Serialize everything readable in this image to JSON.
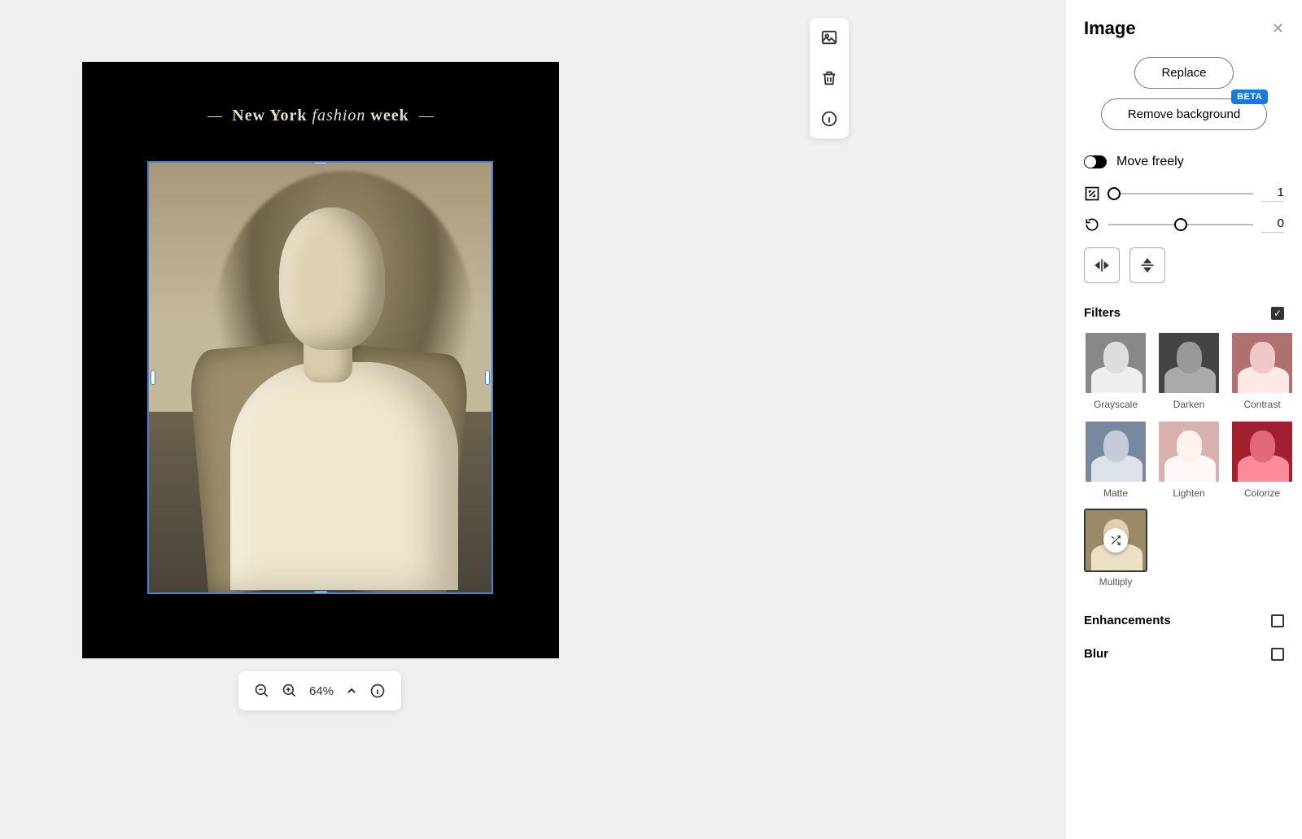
{
  "canvas": {
    "poster_title_prefix": "New York",
    "poster_title_italic": "fashion",
    "poster_title_suffix": "week"
  },
  "actions": {
    "image": "image-icon",
    "trash": "trash-icon",
    "info": "info-icon"
  },
  "zoom": {
    "percent": "64%"
  },
  "panel": {
    "title": "Image",
    "replace_label": "Replace",
    "remove_bg_label": "Remove background",
    "beta_label": "BETA",
    "move_freely_label": "Move freely",
    "move_freely_on": false,
    "scale_value": "1",
    "rotate_value": "0",
    "filters_title": "Filters",
    "filters_enabled": true,
    "filters": [
      {
        "label": "Grayscale",
        "cls": "f-grayscale",
        "selected": false
      },
      {
        "label": "Darken",
        "cls": "f-darken",
        "selected": false
      },
      {
        "label": "Contrast",
        "cls": "f-contrast",
        "selected": false
      },
      {
        "label": "Matte",
        "cls": "f-matte",
        "selected": false
      },
      {
        "label": "Lighten",
        "cls": "f-lighten",
        "selected": false
      },
      {
        "label": "Colorize",
        "cls": "f-colorize",
        "selected": false
      },
      {
        "label": "Multiply",
        "cls": "f-multiply",
        "selected": true
      }
    ],
    "enhancements_title": "Enhancements",
    "enhancements_enabled": false,
    "blur_title": "Blur",
    "blur_enabled": false
  }
}
